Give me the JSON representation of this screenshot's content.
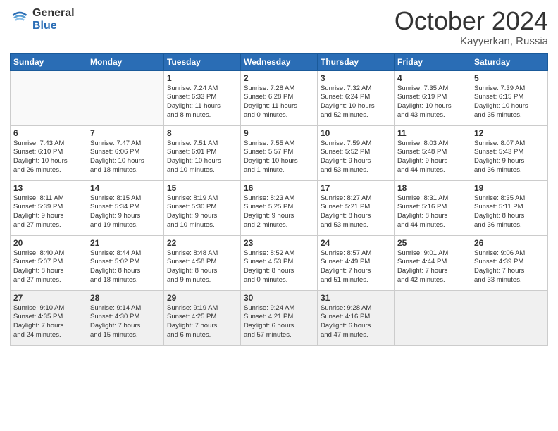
{
  "header": {
    "logo_general": "General",
    "logo_blue": "Blue",
    "month_title": "October 2024",
    "subtitle": "Kayyerkan, Russia"
  },
  "days_of_week": [
    "Sunday",
    "Monday",
    "Tuesday",
    "Wednesday",
    "Thursday",
    "Friday",
    "Saturday"
  ],
  "weeks": [
    [
      {
        "day": "",
        "info": ""
      },
      {
        "day": "",
        "info": ""
      },
      {
        "day": "1",
        "info": "Sunrise: 7:24 AM\nSunset: 6:33 PM\nDaylight: 11 hours\nand 8 minutes."
      },
      {
        "day": "2",
        "info": "Sunrise: 7:28 AM\nSunset: 6:28 PM\nDaylight: 11 hours\nand 0 minutes."
      },
      {
        "day": "3",
        "info": "Sunrise: 7:32 AM\nSunset: 6:24 PM\nDaylight: 10 hours\nand 52 minutes."
      },
      {
        "day": "4",
        "info": "Sunrise: 7:35 AM\nSunset: 6:19 PM\nDaylight: 10 hours\nand 43 minutes."
      },
      {
        "day": "5",
        "info": "Sunrise: 7:39 AM\nSunset: 6:15 PM\nDaylight: 10 hours\nand 35 minutes."
      }
    ],
    [
      {
        "day": "6",
        "info": "Sunrise: 7:43 AM\nSunset: 6:10 PM\nDaylight: 10 hours\nand 26 minutes."
      },
      {
        "day": "7",
        "info": "Sunrise: 7:47 AM\nSunset: 6:06 PM\nDaylight: 10 hours\nand 18 minutes."
      },
      {
        "day": "8",
        "info": "Sunrise: 7:51 AM\nSunset: 6:01 PM\nDaylight: 10 hours\nand 10 minutes."
      },
      {
        "day": "9",
        "info": "Sunrise: 7:55 AM\nSunset: 5:57 PM\nDaylight: 10 hours\nand 1 minute."
      },
      {
        "day": "10",
        "info": "Sunrise: 7:59 AM\nSunset: 5:52 PM\nDaylight: 9 hours\nand 53 minutes."
      },
      {
        "day": "11",
        "info": "Sunrise: 8:03 AM\nSunset: 5:48 PM\nDaylight: 9 hours\nand 44 minutes."
      },
      {
        "day": "12",
        "info": "Sunrise: 8:07 AM\nSunset: 5:43 PM\nDaylight: 9 hours\nand 36 minutes."
      }
    ],
    [
      {
        "day": "13",
        "info": "Sunrise: 8:11 AM\nSunset: 5:39 PM\nDaylight: 9 hours\nand 27 minutes."
      },
      {
        "day": "14",
        "info": "Sunrise: 8:15 AM\nSunset: 5:34 PM\nDaylight: 9 hours\nand 19 minutes."
      },
      {
        "day": "15",
        "info": "Sunrise: 8:19 AM\nSunset: 5:30 PM\nDaylight: 9 hours\nand 10 minutes."
      },
      {
        "day": "16",
        "info": "Sunrise: 8:23 AM\nSunset: 5:25 PM\nDaylight: 9 hours\nand 2 minutes."
      },
      {
        "day": "17",
        "info": "Sunrise: 8:27 AM\nSunset: 5:21 PM\nDaylight: 8 hours\nand 53 minutes."
      },
      {
        "day": "18",
        "info": "Sunrise: 8:31 AM\nSunset: 5:16 PM\nDaylight: 8 hours\nand 44 minutes."
      },
      {
        "day": "19",
        "info": "Sunrise: 8:35 AM\nSunset: 5:11 PM\nDaylight: 8 hours\nand 36 minutes."
      }
    ],
    [
      {
        "day": "20",
        "info": "Sunrise: 8:40 AM\nSunset: 5:07 PM\nDaylight: 8 hours\nand 27 minutes."
      },
      {
        "day": "21",
        "info": "Sunrise: 8:44 AM\nSunset: 5:02 PM\nDaylight: 8 hours\nand 18 minutes."
      },
      {
        "day": "22",
        "info": "Sunrise: 8:48 AM\nSunset: 4:58 PM\nDaylight: 8 hours\nand 9 minutes."
      },
      {
        "day": "23",
        "info": "Sunrise: 8:52 AM\nSunset: 4:53 PM\nDaylight: 8 hours\nand 0 minutes."
      },
      {
        "day": "24",
        "info": "Sunrise: 8:57 AM\nSunset: 4:49 PM\nDaylight: 7 hours\nand 51 minutes."
      },
      {
        "day": "25",
        "info": "Sunrise: 9:01 AM\nSunset: 4:44 PM\nDaylight: 7 hours\nand 42 minutes."
      },
      {
        "day": "26",
        "info": "Sunrise: 9:06 AM\nSunset: 4:39 PM\nDaylight: 7 hours\nand 33 minutes."
      }
    ],
    [
      {
        "day": "27",
        "info": "Sunrise: 9:10 AM\nSunset: 4:35 PM\nDaylight: 7 hours\nand 24 minutes."
      },
      {
        "day": "28",
        "info": "Sunrise: 9:14 AM\nSunset: 4:30 PM\nDaylight: 7 hours\nand 15 minutes."
      },
      {
        "day": "29",
        "info": "Sunrise: 9:19 AM\nSunset: 4:25 PM\nDaylight: 7 hours\nand 6 minutes."
      },
      {
        "day": "30",
        "info": "Sunrise: 9:24 AM\nSunset: 4:21 PM\nDaylight: 6 hours\nand 57 minutes."
      },
      {
        "day": "31",
        "info": "Sunrise: 9:28 AM\nSunset: 4:16 PM\nDaylight: 6 hours\nand 47 minutes."
      },
      {
        "day": "",
        "info": ""
      },
      {
        "day": "",
        "info": ""
      }
    ]
  ]
}
